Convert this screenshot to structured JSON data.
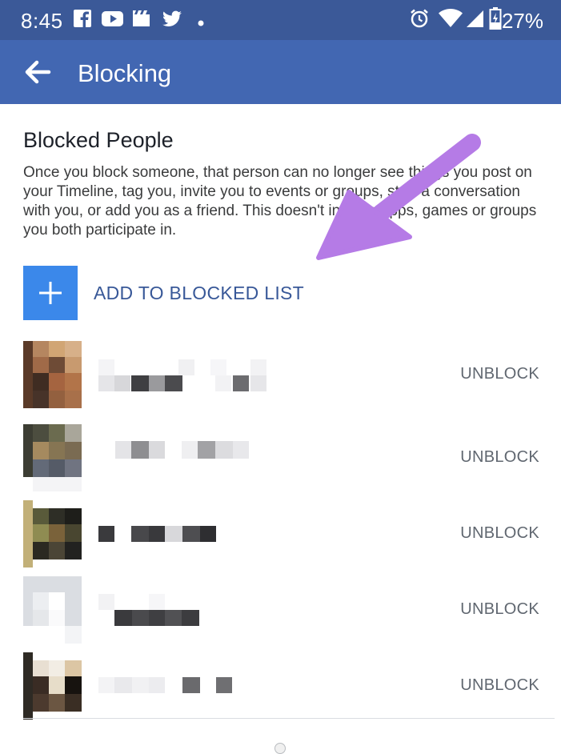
{
  "status_bar": {
    "time": "8:45",
    "battery": "27%"
  },
  "app_bar": {
    "title": "Blocking"
  },
  "section": {
    "title": "Blocked People",
    "description": "Once you block someone, that person can no longer see things you post on your Timeline, tag you, invite you to events or groups, start a conversation with you, or add you as a friend. This doesn't include apps, games or groups you both participate in."
  },
  "add_button": {
    "label": "ADD TO BLOCKED LIST"
  },
  "blocked": [
    {
      "action": "UNBLOCK"
    },
    {
      "action": "UNBLOCK"
    },
    {
      "action": "UNBLOCK"
    },
    {
      "action": "UNBLOCK"
    },
    {
      "action": "UNBLOCK"
    }
  ],
  "colors": {
    "status_bar": "#3b5998",
    "app_bar": "#4267b2",
    "accent": "#3b88ea",
    "link": "#385898",
    "annotation_arrow": "#b57be6"
  }
}
